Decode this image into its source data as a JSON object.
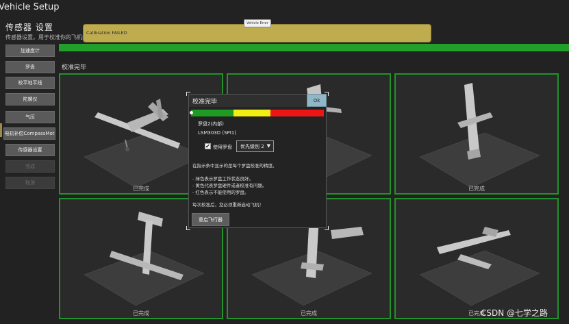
{
  "app": {
    "title": "Vehicle Setup"
  },
  "page": {
    "heading": "传感器 设置",
    "subtitle": "传感器设置。用于校准你的飞机内部的各类传感器和飞机"
  },
  "sidebar": {
    "items": [
      {
        "label": "加速度计",
        "enabled": true
      },
      {
        "label": "罗盘",
        "enabled": true
      },
      {
        "label": "校平地平线",
        "enabled": true
      },
      {
        "label": "陀螺仪",
        "enabled": true
      },
      {
        "label": "气压",
        "enabled": true
      },
      {
        "label": "电机补偿CompassMot",
        "enabled": true
      },
      {
        "label": "传感器设置",
        "enabled": true
      },
      {
        "label": "完成",
        "enabled": false
      },
      {
        "label": "取消",
        "enabled": false
      }
    ]
  },
  "alert": {
    "tag": "Vehicle Error",
    "message": "Calibration FAILED"
  },
  "calibration": {
    "progress_percent": 100,
    "status_text": "校准完毕",
    "tile_label": "已完成"
  },
  "dialog": {
    "title": "校准完毕",
    "ok_label": "Ok",
    "bar_segments": [
      {
        "color": "#1f9a22",
        "fraction": 0.32
      },
      {
        "color": "#f2ee12",
        "fraction": 0.28
      },
      {
        "color": "#ee1515",
        "fraction": 0.4
      }
    ],
    "compass_name": "罗盘2(内部)",
    "sensor_name": "LSM303D (SPI1)",
    "use_compass_label": "使用罗盘",
    "use_compass_checked": true,
    "checkmark": "✔",
    "priority_value": "优先级别 2",
    "info_lines": [
      "在指示条中显示的是每个罗盘校准的精度。",
      "- 绿色表示罗盘工作状态良好。",
      "- 黄色代表罗盘硬件或者校准有问题。",
      "- 红色表示不能使用的罗盘。",
      "每次校准后，您必须重新启动飞机！"
    ],
    "reboot_label": "重启飞行器"
  },
  "watermark": "CSDN @七学之路",
  "colors": {
    "accent_green": "#229e2a",
    "alert_yellow": "#bfac4e"
  }
}
